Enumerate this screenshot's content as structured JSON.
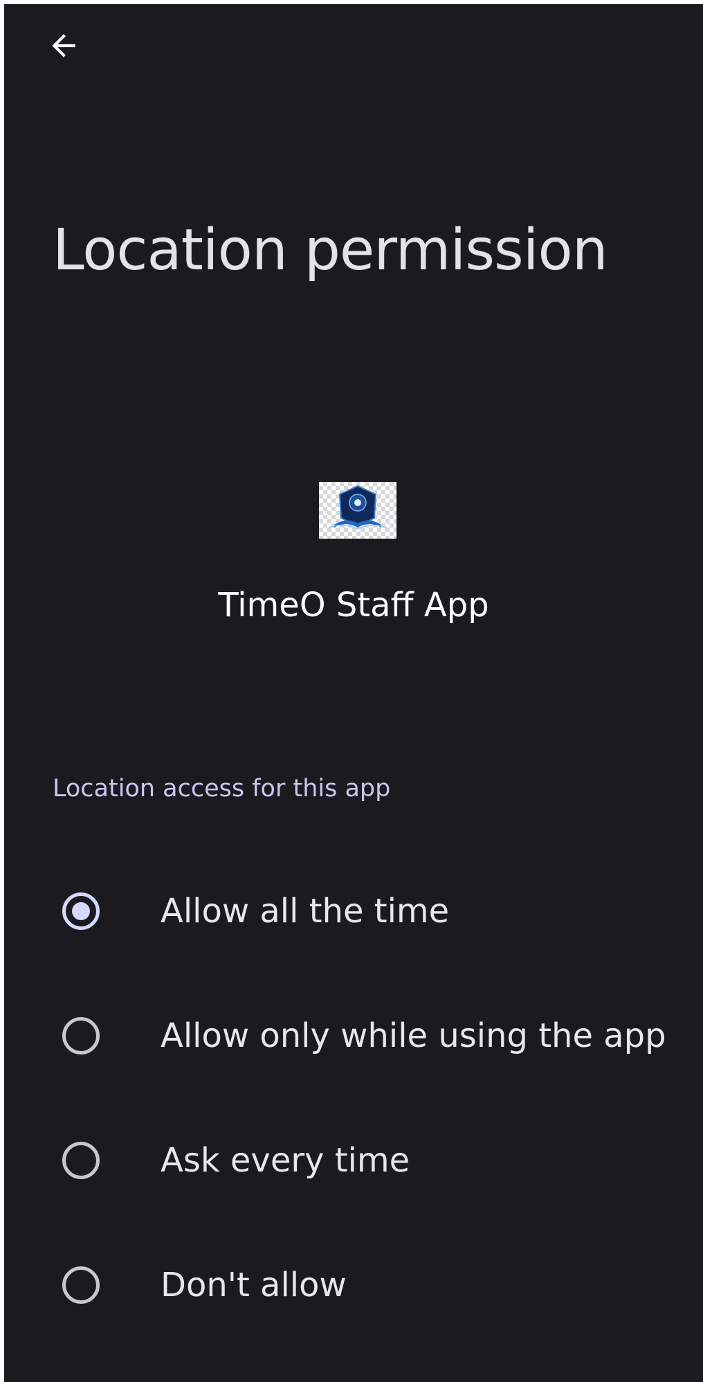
{
  "header": {
    "back_icon": "arrow-back-icon"
  },
  "page": {
    "title": "Location permission"
  },
  "app": {
    "icon": "app-logo-icon",
    "name": "TimeO Staff App"
  },
  "section": {
    "label": "Location access for this app"
  },
  "options": [
    {
      "label": "Allow all the time",
      "selected": true
    },
    {
      "label": "Allow only while using the app",
      "selected": false
    },
    {
      "label": "Ask every time",
      "selected": false
    },
    {
      "label": "Don't allow",
      "selected": false
    }
  ],
  "colors": {
    "background": "#1b1b1f",
    "accent": "#d6d9ff",
    "text": "#e4e2e6",
    "section_label": "#c6c8f0"
  }
}
